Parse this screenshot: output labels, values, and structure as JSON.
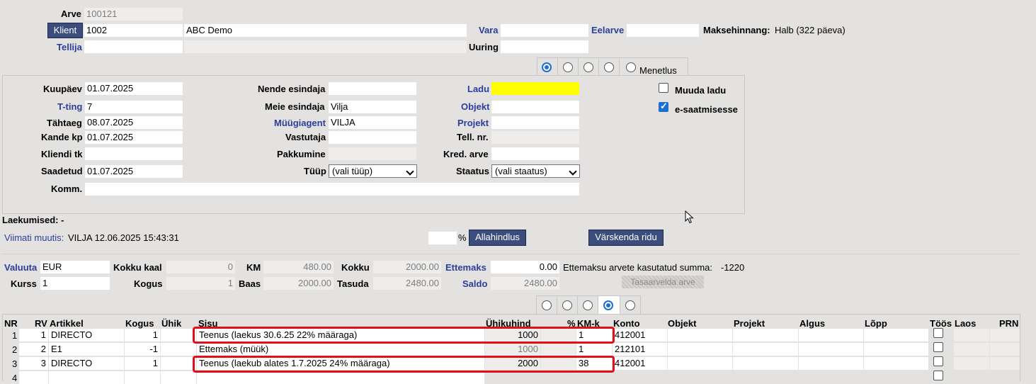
{
  "header": {
    "arve_label": "Arve",
    "arve_value": "100121",
    "klient_button": "Klient",
    "klient_code": "1002",
    "klient_name": "ABC Demo",
    "vara_label": "Vara",
    "vara_value": "",
    "eelarve_label": "Eelarve",
    "eelarve_value": "",
    "maksehinnang_label": "Maksehinnang:",
    "maksehinnang_value": "Halb (322 päeva)",
    "tellija_label": "Tellija",
    "tellija_value": "",
    "uuring_label": "Uuring",
    "uuring_value": ""
  },
  "tabs_top": {
    "menetlus_label": "Menetlus",
    "selected_index": 0
  },
  "form": {
    "kuupaev_label": "Kuupäev",
    "kuupaev_value": "01.07.2025",
    "tting_label": "T-ting",
    "tting_value": "7",
    "tahtaeg_label": "Tähtaeg",
    "tahtaeg_value": "08.07.2025",
    "kande_label": "Kande kp",
    "kande_value": "01.07.2025",
    "kliendi_tk_label": "Kliendi tk",
    "kliendi_tk_value": "",
    "saadetud_label": "Saadetud",
    "saadetud_value": "01.07.2025",
    "komm_label": "Komm.",
    "komm_value": "",
    "nende_label": "Nende esindaja",
    "nende_value": "",
    "meie_label": "Meie esindaja",
    "meie_value": "Vilja",
    "myygiagent_label": "Müügiagent",
    "myygiagent_value": "VILJA",
    "vastutaja_label": "Vastutaja",
    "vastutaja_value": "",
    "pakkumine_label": "Pakkumine",
    "pakkumine_value": "",
    "tyyp_label": "Tüüp",
    "tyyp_value": "(vali tüüp)",
    "ladu_label": "Ladu",
    "ladu_value": "",
    "objekt_label": "Objekt",
    "objekt_value": "",
    "projekt_label": "Projekt",
    "projekt_value": "",
    "tellnr_label": "Tell. nr.",
    "tellnr_value": "",
    "kred_label": "Kred. arve",
    "kred_value": "",
    "staatus_label": "Staatus",
    "staatus_value": "(vali staatus)",
    "muuda_ladu_label": "Muuda ladu",
    "muuda_ladu_checked": false,
    "esaatmine_label": "e-saatmisesse",
    "esaatmine_checked": true
  },
  "status": {
    "laekumised": "Laekumised: -",
    "viimati_label": "Viimati muutis:",
    "viimati_value": "VILJA 12.06.2025 15:43:31",
    "percent_value": "",
    "percent_sign": "%",
    "allahindlus_button": "Allahindlus",
    "varskenda_button": "Värskenda ridu"
  },
  "totals": {
    "valuuta_label": "Valuuta",
    "valuuta_value": "EUR",
    "kurss_label": "Kurss",
    "kurss_value": "1",
    "kokku_kaal_label": "Kokku kaal",
    "kokku_kaal_value": "0",
    "kogus_label": "Kogus",
    "kogus_value": "1",
    "km_label": "KM",
    "km_value": "480.00",
    "baas_label": "Baas",
    "baas_value": "2000.00",
    "kokku_label": "Kokku",
    "kokku_value": "2000.00",
    "tasuda_label": "Tasuda",
    "tasuda_value": "2480.00",
    "ettemaks_label": "Ettemaks",
    "ettemaks_value": "0.00",
    "saldo_label": "Saldo",
    "saldo_value": "2480.00",
    "ettemaksu_text": "Ettemaksu arvete kasutatud summa:",
    "ettemaksu_value": "-1220",
    "tasaarvelda_button": "Tasaarvelda arve"
  },
  "tabs_rows": {
    "selected_index": 3
  },
  "table": {
    "headers": [
      "NR",
      "RV",
      "Artikkel",
      "Kogus",
      "Ühik",
      "Sisu",
      "Ühikuhind",
      "%",
      "KM-k",
      "Konto",
      "Objekt",
      "Projekt",
      "Algus",
      "Lõpp",
      "Töös",
      "Laos",
      "PRN"
    ],
    "rows": [
      {
        "nr": "1",
        "rv": "1",
        "artikkel": "DIRECTO",
        "kogus": "1",
        "uhik": "",
        "sisu": "Teenus (laekus 30.6.25 22% määraga)",
        "hind": "1000",
        "pct": "",
        "kmk": "1",
        "konto": "412001"
      },
      {
        "nr": "2",
        "rv": "2",
        "artikkel": "E1",
        "kogus": "-1",
        "uhik": "",
        "sisu": "Ettemaks (müük)",
        "hind": "1000",
        "pct": "",
        "kmk": "1",
        "konto": "212101"
      },
      {
        "nr": "3",
        "rv": "3",
        "artikkel": "DIRECTO",
        "kogus": "1",
        "uhik": "",
        "sisu": "Teenus  (laekub alates 1.7.2025 24% määraga)",
        "hind": "2000",
        "pct": "",
        "kmk": "38",
        "konto": "412001"
      },
      {
        "nr": "4"
      }
    ]
  },
  "colors": {
    "link": "#2a3e9a",
    "highlight": "#e0101a",
    "ladu": "#ffff00",
    "button": "#3a4d7c"
  }
}
